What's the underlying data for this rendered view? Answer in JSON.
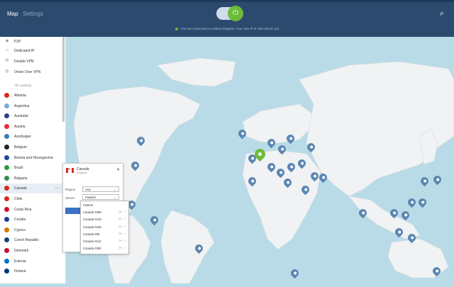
{
  "tabs": [
    {
      "label": "Map"
    },
    {
      "label": "Settings"
    }
  ],
  "status": {
    "text": "You are connected to United Kingdom. Your new IP is 109.230.61.112"
  },
  "sidebar": {
    "specialty": [
      {
        "label": "P2P",
        "icon": "p2p-icon"
      },
      {
        "label": "Dedicated IP",
        "icon": "home-icon"
      },
      {
        "label": "Double VPN",
        "icon": "double-vpn-icon"
      },
      {
        "label": "Onion Over VPN",
        "icon": "onion-icon"
      }
    ],
    "all_countries_label": "All countries",
    "countries": [
      {
        "label": "Albania",
        "color": "#d52b1e"
      },
      {
        "label": "Argentina",
        "color": "#74acdf"
      },
      {
        "label": "Australia",
        "color": "#2a3f8f"
      },
      {
        "label": "Austria",
        "color": "#ed2939"
      },
      {
        "label": "Azerbaijan",
        "color": "#2f7fbf"
      },
      {
        "label": "Belgium",
        "color": "#222222"
      },
      {
        "label": "Bosnia and Herzegovina",
        "color": "#1e4a9a"
      },
      {
        "label": "Brazil",
        "color": "#2b9a3c"
      },
      {
        "label": "Bulgaria",
        "color": "#2d8f4e"
      },
      {
        "label": "Canada",
        "color": "#d52b1e"
      },
      {
        "label": "Chile",
        "color": "#d52b1e"
      },
      {
        "label": "Costa Rica",
        "color": "#c8102e"
      },
      {
        "label": "Croatia",
        "color": "#1b3f93"
      },
      {
        "label": "Cyprus",
        "color": "#d57800"
      },
      {
        "label": "Czech Republic",
        "color": "#11457e"
      },
      {
        "label": "Denmark",
        "color": "#c8102e"
      },
      {
        "label": "Estonia",
        "color": "#0072ce"
      },
      {
        "label": "Finland",
        "color": "#003580"
      }
    ]
  },
  "popup": {
    "title": "Canada",
    "subtitle": "8 regions",
    "region_label": "Region",
    "region_value": "Any",
    "server_label": "Server",
    "server_value": "Fastest"
  },
  "dropdown": [
    {
      "label": "Fastest",
      "load": ""
    },
    {
      "label": "Canada #385",
      "load": "2%"
    },
    {
      "label": "Canada #133",
      "load": "2%"
    },
    {
      "label": "Canada #185",
      "load": "2%"
    },
    {
      "label": "Canada #96",
      "load": "2%"
    },
    {
      "label": "Canada #112",
      "load": "2%"
    },
    {
      "label": "Canada #280",
      "load": "2%"
    }
  ],
  "colors": {
    "header": "#2c4a6e",
    "accent": "#6dbb3a",
    "pin": "#5b86b0",
    "water": "#b9dbe8",
    "land": "#f0f2f3"
  }
}
